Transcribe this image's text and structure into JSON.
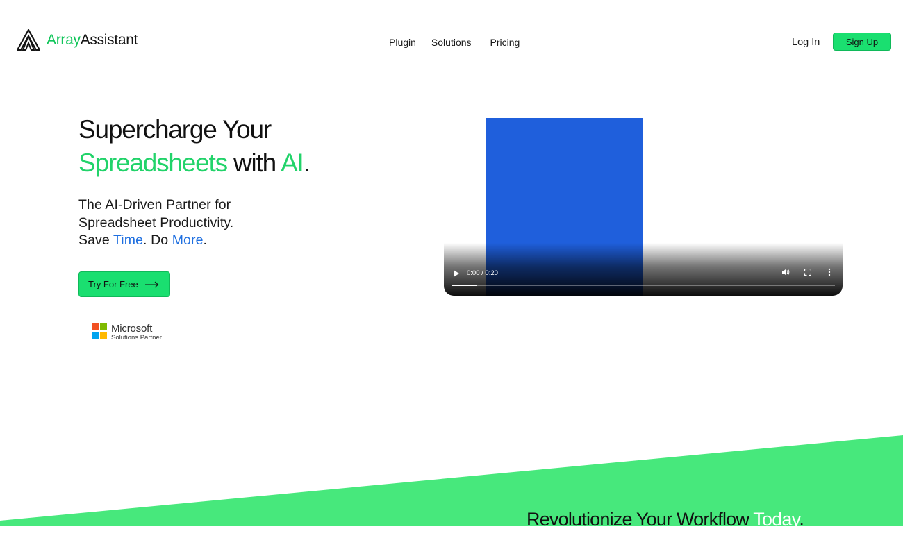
{
  "header": {
    "logo": {
      "part1": "Array",
      "part2": "Assistant"
    },
    "nav": [
      {
        "label": "Plugin"
      },
      {
        "label": "Solutions"
      },
      {
        "label": "Pricing"
      }
    ],
    "login_label": "Log In",
    "signup_label": "Sign Up"
  },
  "hero": {
    "title_line1": "Supercharge Your",
    "title_green1": "Spreadsheets",
    "title_mid": " with ",
    "title_green2": "AI",
    "title_end": ".",
    "sub_line1": "The AI-Driven Partner for",
    "sub_line2": "Spreadsheet Productivity.",
    "sub_save": "Save ",
    "sub_time": "Time",
    "sub_do": ". Do ",
    "sub_more": "More",
    "sub_end": ".",
    "cta_label": "Try For Free",
    "partner_name": "Microsoft",
    "partner_sub": "Solutions Partner"
  },
  "video": {
    "timecode": "0:00 / 0:20",
    "progress": 0.065
  },
  "bottom": {
    "heading_pre": "Revolutionize Your Workflow ",
    "heading_highlight": "Today",
    "heading_end": "."
  },
  "colors": {
    "brand_green": "#22d36a",
    "button_green": "#1adf70",
    "wedge_green": "#47e87c",
    "link_blue": "#1f6fe0",
    "video_blue": "#1f5fdc"
  },
  "icons": [
    "arrayassistant-logo-icon",
    "arrow-right-icon",
    "microsoft-logo-icon",
    "play-icon",
    "volume-icon",
    "fullscreen-icon",
    "more-options-icon"
  ]
}
